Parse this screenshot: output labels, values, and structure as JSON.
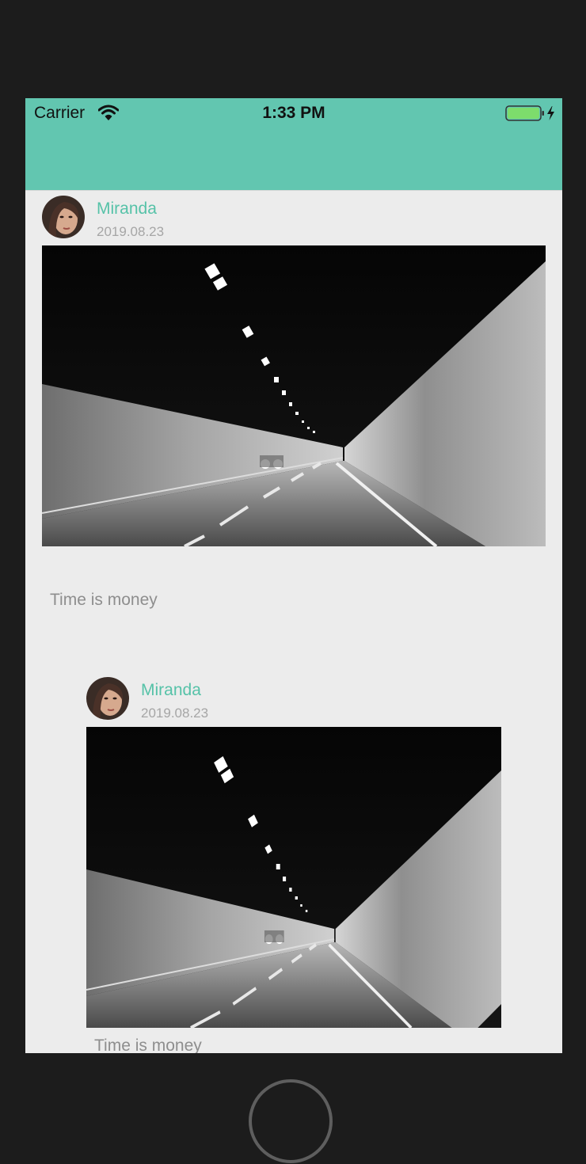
{
  "status_bar": {
    "carrier": "Carrier",
    "time": "1:33 PM",
    "icons": [
      "wifi-icon",
      "battery-icon",
      "charging-bolt-icon"
    ],
    "background_color": "#62c6b0"
  },
  "colors": {
    "accent": "#56c2a8",
    "screen_background": "#ececec",
    "device_frame": "#1c1c1c"
  },
  "posts": [
    {
      "username": "Miranda",
      "date": "2019.08.23",
      "caption": "Time is money",
      "image": "tunnel-photo"
    },
    {
      "username": "Miranda",
      "date": "2019.08.23",
      "caption": "Time is money",
      "image": "tunnel-photo"
    }
  ]
}
